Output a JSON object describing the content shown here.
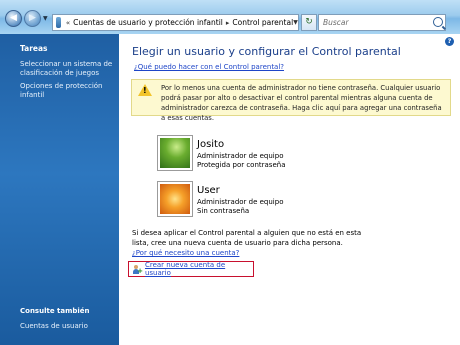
{
  "address": {
    "crumbs": [
      "Cuentas de usuario y protección infantil",
      "Control parental"
    ]
  },
  "search": {
    "placeholder": "Buscar"
  },
  "sidebar": {
    "tasks_header": "Tareas",
    "tasks": [
      "Seleccionar un sistema de clasificación de juegos",
      "Opciones de protección infantil"
    ],
    "see_also_header": "Consulte también",
    "see_also": [
      "Cuentas de usuario"
    ]
  },
  "main": {
    "title": "Elegir un usuario y configurar el Control parental",
    "help_link": "¿Qué puedo hacer con el Control parental?",
    "warning": "Por lo menos una cuenta de administrador no tiene contraseña. Cualquier usuario podrá pasar por alto o desactivar el control parental mientras alguna cuenta de administrador carezca de contraseña. Haga clic aquí para agregar una contraseña a esas cuentas.",
    "users": [
      {
        "name": "Josito",
        "line1": "Administrador de equipo",
        "line2": "Protegida por contraseña"
      },
      {
        "name": "User",
        "line1": "Administrador de equipo",
        "line2": "Sin contraseña"
      }
    ],
    "info_text": "Si desea aplicar el Control parental a alguien que no está en esta lista, cree una nueva cuenta de usuario para dicha persona.",
    "why_link": "¿Por qué necesito una cuenta?",
    "create_link": "Crear nueva cuenta de usuario"
  },
  "colors": {
    "sidebar": "#2d77bf",
    "title": "#1b3f8a",
    "link": "#1f46c8",
    "warning_bg": "#fdf9d0",
    "highlight": "#c8102e"
  }
}
